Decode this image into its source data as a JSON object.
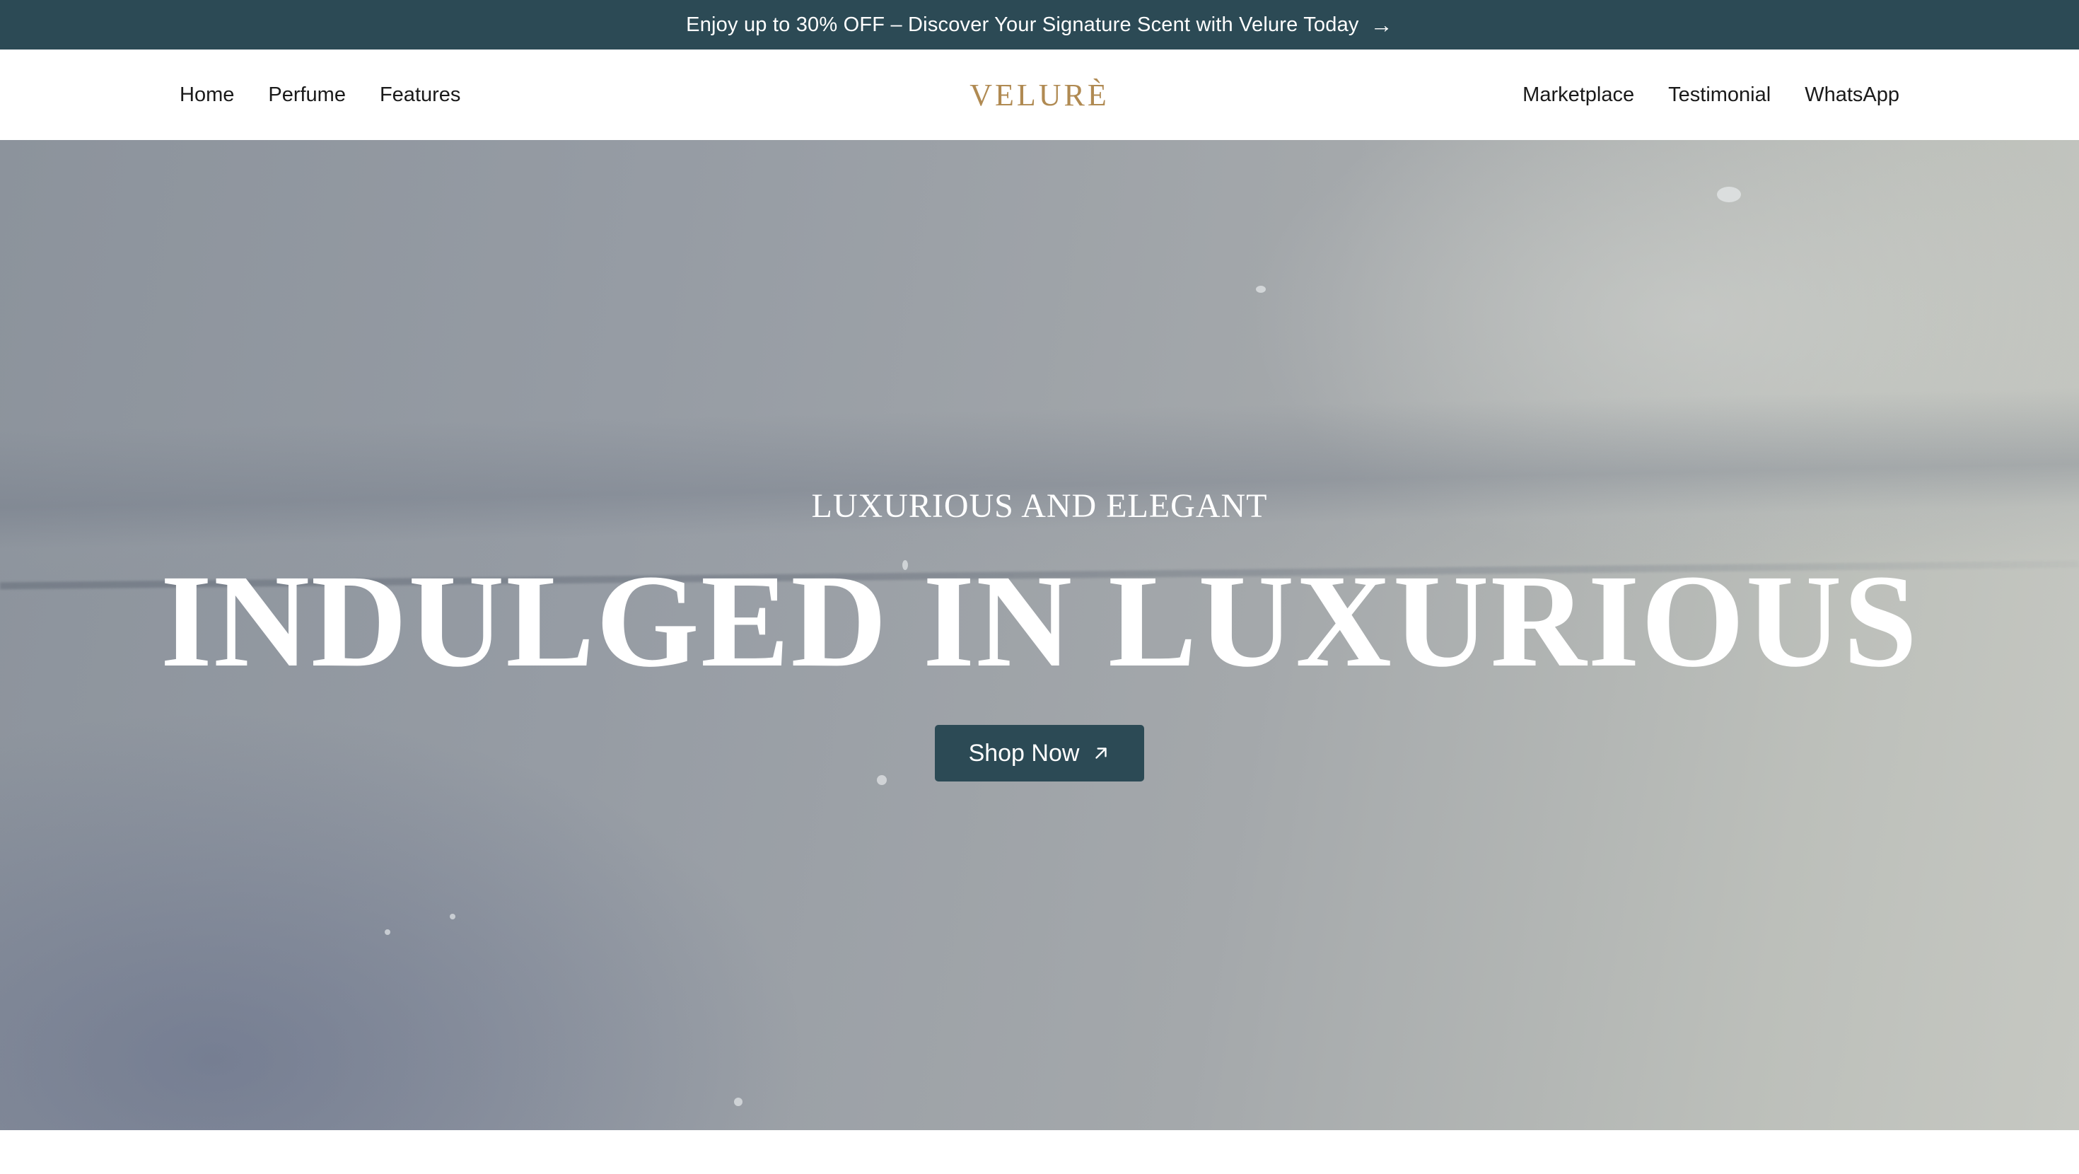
{
  "promo": {
    "text": "Enjoy up to 30% OFF – Discover Your Signature Scent with Velure Today",
    "arrow_icon": "arrow-right-icon"
  },
  "nav": {
    "left": [
      {
        "label": "Home"
      },
      {
        "label": "Perfume"
      },
      {
        "label": "Features"
      }
    ],
    "right": [
      {
        "label": "Marketplace"
      },
      {
        "label": "Testimonial"
      },
      {
        "label": "WhatsApp"
      }
    ],
    "logo": "VELURÈ"
  },
  "hero": {
    "subtitle": "LUXURIOUS AND ELEGANT",
    "title": "INDULGED IN LUXURIOUS",
    "cta_label": "Shop Now",
    "cta_icon": "arrow-up-right-icon"
  },
  "colors": {
    "primary": "#2c4a55",
    "logo_gold": "#b08a52",
    "hero_text": "#ffffff"
  }
}
